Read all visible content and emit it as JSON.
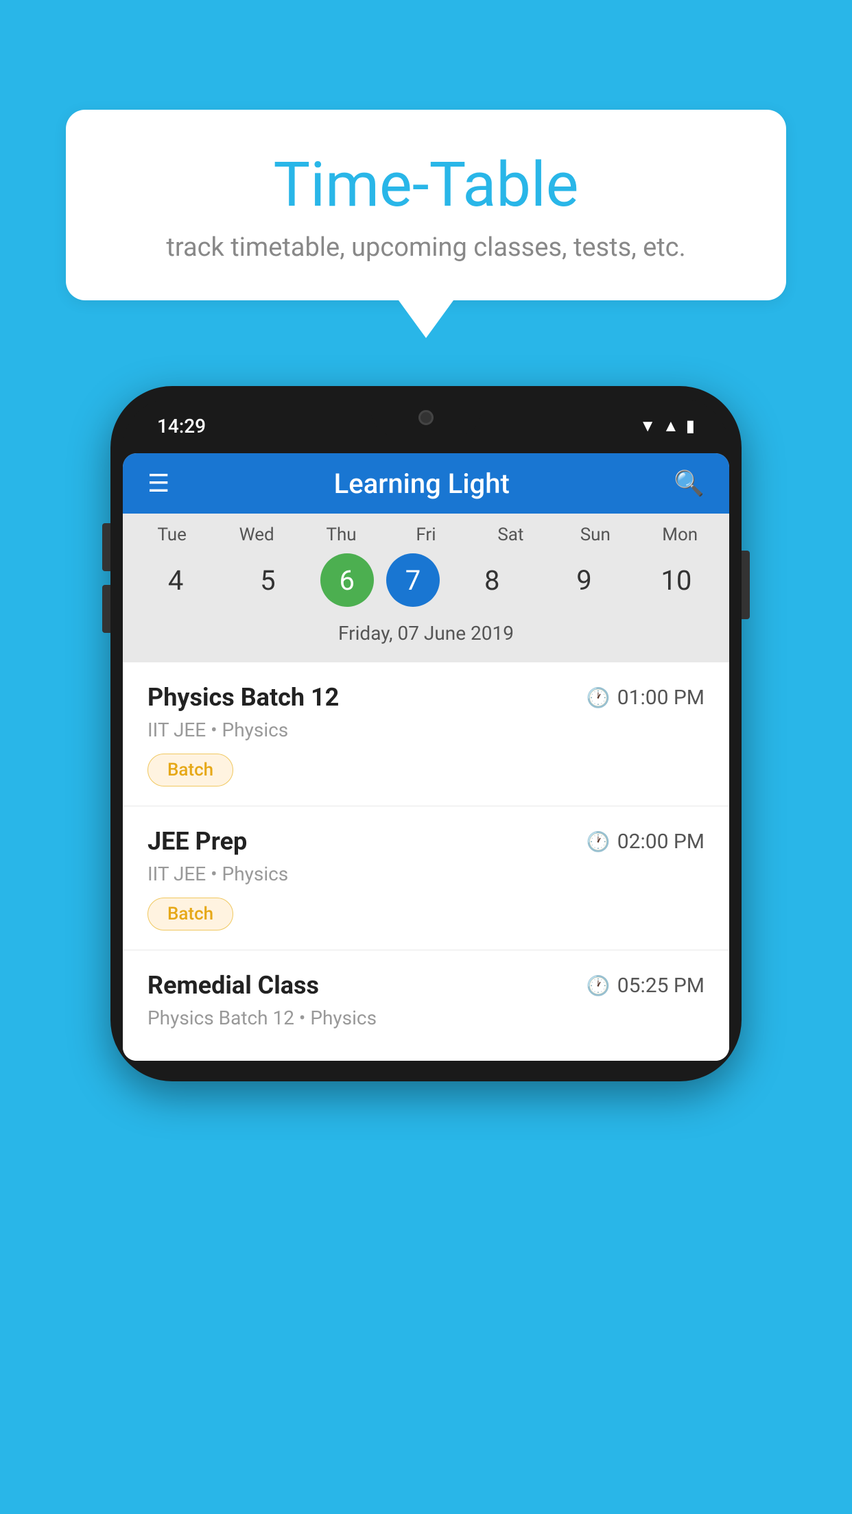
{
  "background_color": "#29b6e8",
  "speech_bubble": {
    "title": "Time-Table",
    "subtitle": "track timetable, upcoming classes, tests, etc."
  },
  "phone": {
    "status_bar": {
      "time": "14:29"
    },
    "app_header": {
      "title": "Learning Light"
    },
    "calendar": {
      "days": [
        {
          "label": "Tue",
          "number": "4"
        },
        {
          "label": "Wed",
          "number": "5"
        },
        {
          "label": "Thu",
          "number": "6",
          "state": "today"
        },
        {
          "label": "Fri",
          "number": "7",
          "state": "selected"
        },
        {
          "label": "Sat",
          "number": "8"
        },
        {
          "label": "Sun",
          "number": "9"
        },
        {
          "label": "Mon",
          "number": "10"
        }
      ],
      "selected_date_label": "Friday, 07 June 2019"
    },
    "schedule": [
      {
        "title": "Physics Batch 12",
        "time": "01:00 PM",
        "sub": "IIT JEE • Physics",
        "tag": "Batch"
      },
      {
        "title": "JEE Prep",
        "time": "02:00 PM",
        "sub": "IIT JEE • Physics",
        "tag": "Batch"
      },
      {
        "title": "Remedial Class",
        "time": "05:25 PM",
        "sub": "Physics Batch 12 • Physics",
        "tag": null
      }
    ]
  }
}
